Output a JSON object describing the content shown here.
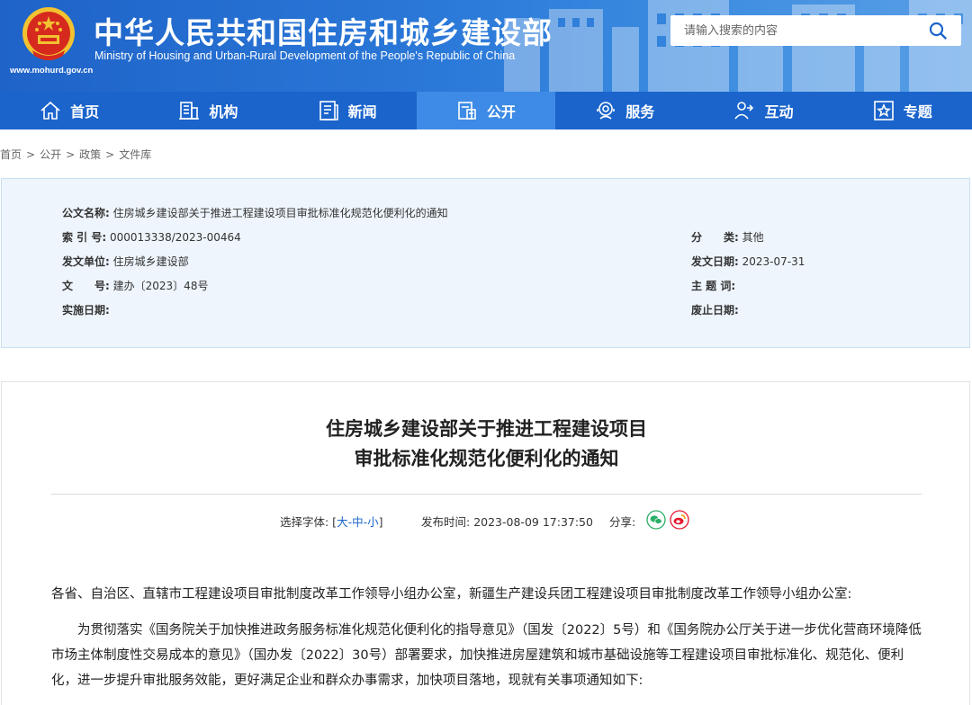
{
  "header": {
    "title": "中华人民共和国住房和城乡建设部",
    "subtitle": "Ministry of Housing and Urban-Rural Development of the People's Republic of China",
    "url": "www.mohurd.gov.cn",
    "search_placeholder": "请输入搜索的内容"
  },
  "nav": [
    {
      "label": "首页",
      "icon": "home-icon"
    },
    {
      "label": "机构",
      "icon": "building-icon"
    },
    {
      "label": "新闻",
      "icon": "news-icon"
    },
    {
      "label": "公开",
      "icon": "document-icon"
    },
    {
      "label": "服务",
      "icon": "service-icon"
    },
    {
      "label": "互动",
      "icon": "interact-icon"
    },
    {
      "label": "专题",
      "icon": "star-icon"
    }
  ],
  "breadcrumb": [
    "首页",
    "公开",
    "政策",
    "文件库"
  ],
  "info": {
    "doc_name_label": "公文名称:",
    "doc_name": "住房城乡建设部关于推进工程建设项目审批标准化规范化便利化的通知",
    "index_label": "索 引 号:",
    "index": "000013338/2023-00464",
    "category_label": "分　　类:",
    "category": "其他",
    "issuer_label": "发文单位:",
    "issuer": "住房城乡建设部",
    "issue_date_label": "发文日期:",
    "issue_date": "2023-07-31",
    "doc_no_label": "文　　号:",
    "doc_no": "建办〔2023〕48号",
    "keywords_label": "主 题 词:",
    "effective_label": "实施日期:",
    "repeal_label": "废止日期:"
  },
  "article": {
    "title_line1": "住房城乡建设部关于推进工程建设项目",
    "title_line2": "审批标准化规范化便利化的通知",
    "font_label": "选择字体: [",
    "font_large": "大",
    "font_medium": "中",
    "font_small": "小",
    "font_close": "]",
    "dash": "-",
    "publish_label": "发布时间:",
    "publish_time": "2023-08-09 17:37:50",
    "share_label": "分享:",
    "para1": "各省、自治区、直辖市工程建设项目审批制度改革工作领导小组办公室，新疆生产建设兵团工程建设项目审批制度改革工作领导小组办公室:",
    "para2": "为贯彻落实《国务院关于加快推进政务服务标准化规范化便利化的指导意见》（国发〔2022〕5号）和《国务院办公厅关于进一步优化营商环境降低市场主体制度性交易成本的意见》（国办发〔2022〕30号）部署要求，加快推进房屋建筑和城市基础设施等工程建设项目审批标准化、规范化、便利化，进一步提升审批服务效能，更好满足企业和群众办事需求，加快项目落地，现就有关事项通知如下:"
  },
  "colors": {
    "header_blue": "#1f63c8",
    "nav_blue": "#1a64cc",
    "nav_active": "#3d8be6",
    "info_bg": "#eef5fc",
    "link_blue": "#1a64cc",
    "wechat_green": "#2aae67",
    "weibo_red": "#e6162d"
  }
}
